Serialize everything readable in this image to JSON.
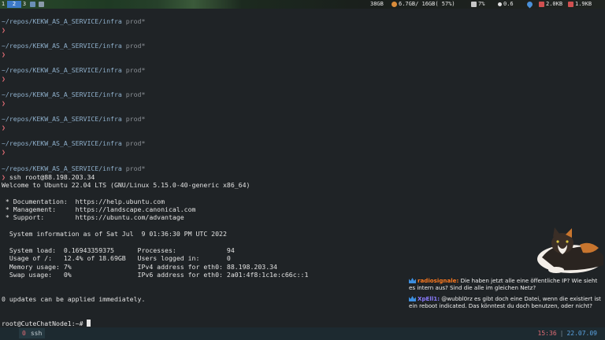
{
  "topbar": {
    "workspaces": [
      "1",
      "2",
      "3"
    ],
    "disk": "38GB",
    "memory": "6.7GB/ 16GB( 57%)",
    "cpu": "7%",
    "load": "0.6",
    "net_down": "2.0KB",
    "net_up": "1.9KB",
    "colors": {
      "active_workspace": "#3c7ac7",
      "accent": "#e06c75"
    }
  },
  "terminal": {
    "prompt_path": "~/repos/KEKW_AS_A_SERVICE/infra",
    "prompt_branch": "prod*",
    "prompt_char": "❯",
    "command": " ssh root@88.198.203.34",
    "welcome": "Welcome to Ubuntu 22.04 LTS (GNU/Linux 5.15.0-40-generic x86_64)",
    "doc_line": " * Documentation:  https://help.ubuntu.com",
    "mgmt_line": " * Management:     https://landscape.canonical.com",
    "support_line": " * Support:        https://ubuntu.com/advantage",
    "sysinfo_line": "  System information as of Sat Jul  9 01:36:30 PM UTC 2022",
    "load_line": "  System load:  0.16943359375      Processes:             94",
    "usage_line": "  Usage of /:   12.4% of 18.69GB   Users logged in:       0",
    "memory_line": "  Memory usage: 7%                 IPv4 address for eth0: 88.198.203.34",
    "swap_line": "  Swap usage:   0%                 IPv6 address for eth0: 2a01:4f8:1c1e:c66c::1",
    "updates_line": "0 updates can be applied immediately.",
    "root_prompt": "root@CuteChatNode1:~# "
  },
  "chat": {
    "messages": [
      {
        "user": "radiosignale:",
        "text": " Die haben jetzt alle eine öffentliche IP? Wie sieht es intern aus? Sind die alle im gleichen Netz?"
      },
      {
        "user": "XpEll1:",
        "text": " @wubbl0rz es gibt doch eine Datei, wenn die existiert ist ein reboot indicated. Das könntest du doch benutzen, oder nicht?"
      }
    ]
  },
  "statusbar": {
    "window_index": "0",
    "window_name": "ssh",
    "time": "15:36",
    "separator": "|",
    "date": "22.07.09"
  }
}
